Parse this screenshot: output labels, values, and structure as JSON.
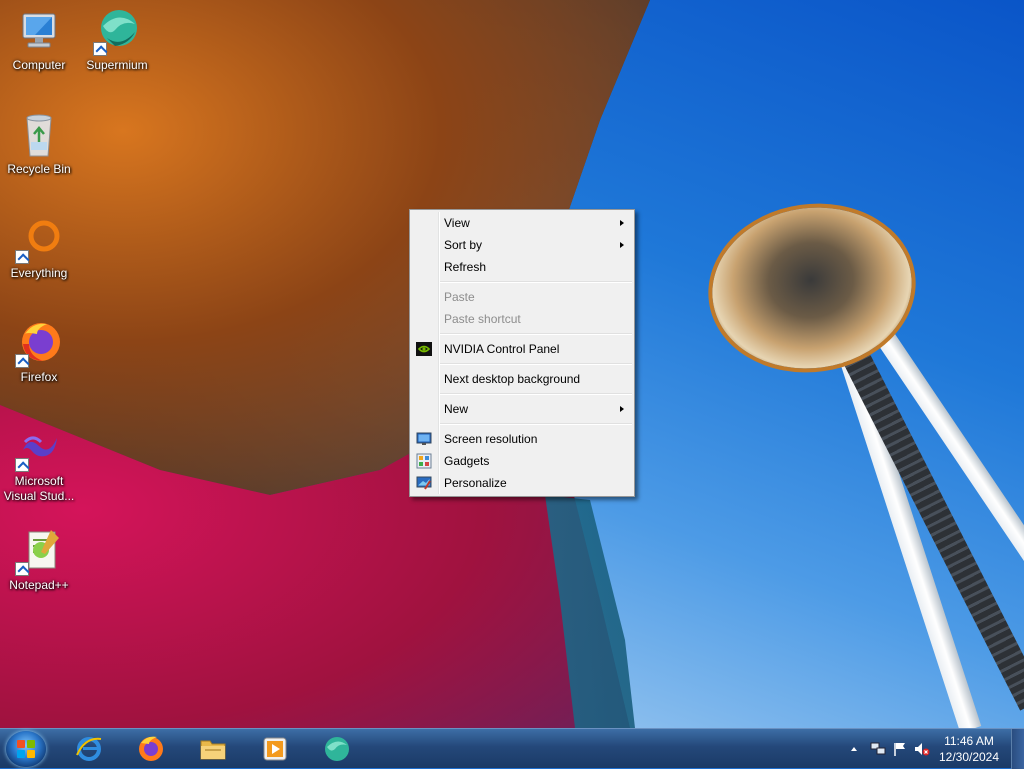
{
  "desktop": {
    "icons": [
      {
        "label": "Computer",
        "icon": "computer-icon"
      },
      {
        "label": "Supermium",
        "icon": "supermium-icon"
      },
      {
        "label": "Recycle Bin",
        "icon": "recycle-bin-icon"
      },
      {
        "label": "Everything",
        "icon": "everything-icon"
      },
      {
        "label": "Firefox",
        "icon": "firefox-icon"
      },
      {
        "label": "Microsoft Visual Stud...",
        "icon": "visual-studio-icon"
      },
      {
        "label": "Notepad++",
        "icon": "notepad-plus-plus-icon"
      }
    ]
  },
  "context_menu": {
    "items": [
      {
        "label": "View",
        "submenu": true,
        "enabled": true
      },
      {
        "label": "Sort by",
        "submenu": true,
        "enabled": true
      },
      {
        "label": "Refresh",
        "submenu": false,
        "enabled": true
      },
      {
        "label": "Paste",
        "submenu": false,
        "enabled": false
      },
      {
        "label": "Paste shortcut",
        "submenu": false,
        "enabled": false
      },
      {
        "label": "NVIDIA Control Panel",
        "submenu": false,
        "enabled": true,
        "icon": "nvidia-icon"
      },
      {
        "label": "Next desktop background",
        "submenu": false,
        "enabled": true
      },
      {
        "label": "New",
        "submenu": true,
        "enabled": true
      },
      {
        "label": "Screen resolution",
        "submenu": false,
        "enabled": true,
        "icon": "screen-resolution-icon"
      },
      {
        "label": "Gadgets",
        "submenu": false,
        "enabled": true,
        "icon": "gadgets-icon"
      },
      {
        "label": "Personalize",
        "submenu": false,
        "enabled": true,
        "icon": "personalize-icon"
      }
    ]
  },
  "taskbar": {
    "pinned": [
      {
        "name": "Internet Explorer",
        "icon": "internet-explorer-icon"
      },
      {
        "name": "Firefox",
        "icon": "firefox-icon"
      },
      {
        "name": "File Explorer",
        "icon": "folder-icon"
      },
      {
        "name": "Media Player",
        "icon": "media-player-icon"
      },
      {
        "name": "Supermium",
        "icon": "supermium-icon"
      }
    ],
    "clock": {
      "time": "11:46 AM",
      "date": "12/30/2024"
    }
  },
  "colors": {
    "taskbar": "#24487a",
    "menu_background": "#f0f0f0",
    "disabled_text": "#8d8d8d"
  }
}
